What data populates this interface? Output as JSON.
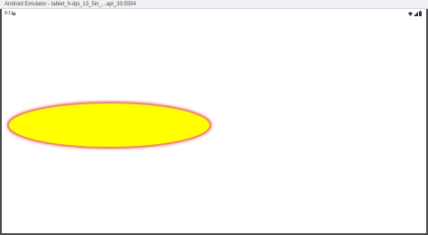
{
  "window": {
    "title": "Android Emulator - tablet_h-dpi_13_5in_...api_33:5554"
  },
  "status_bar": {
    "time": "8:11",
    "icons": [
      "gear-icon",
      "wifi-icon",
      "signal-icon",
      "battery-icon"
    ]
  },
  "canvas": {
    "shape": "ellipse",
    "fill_color": "#ffff00",
    "stroke_color": "#f08080"
  },
  "colors": {
    "frame": "#4a4a4a",
    "titlebar": "#eef0f3",
    "background": "#ffffff"
  }
}
